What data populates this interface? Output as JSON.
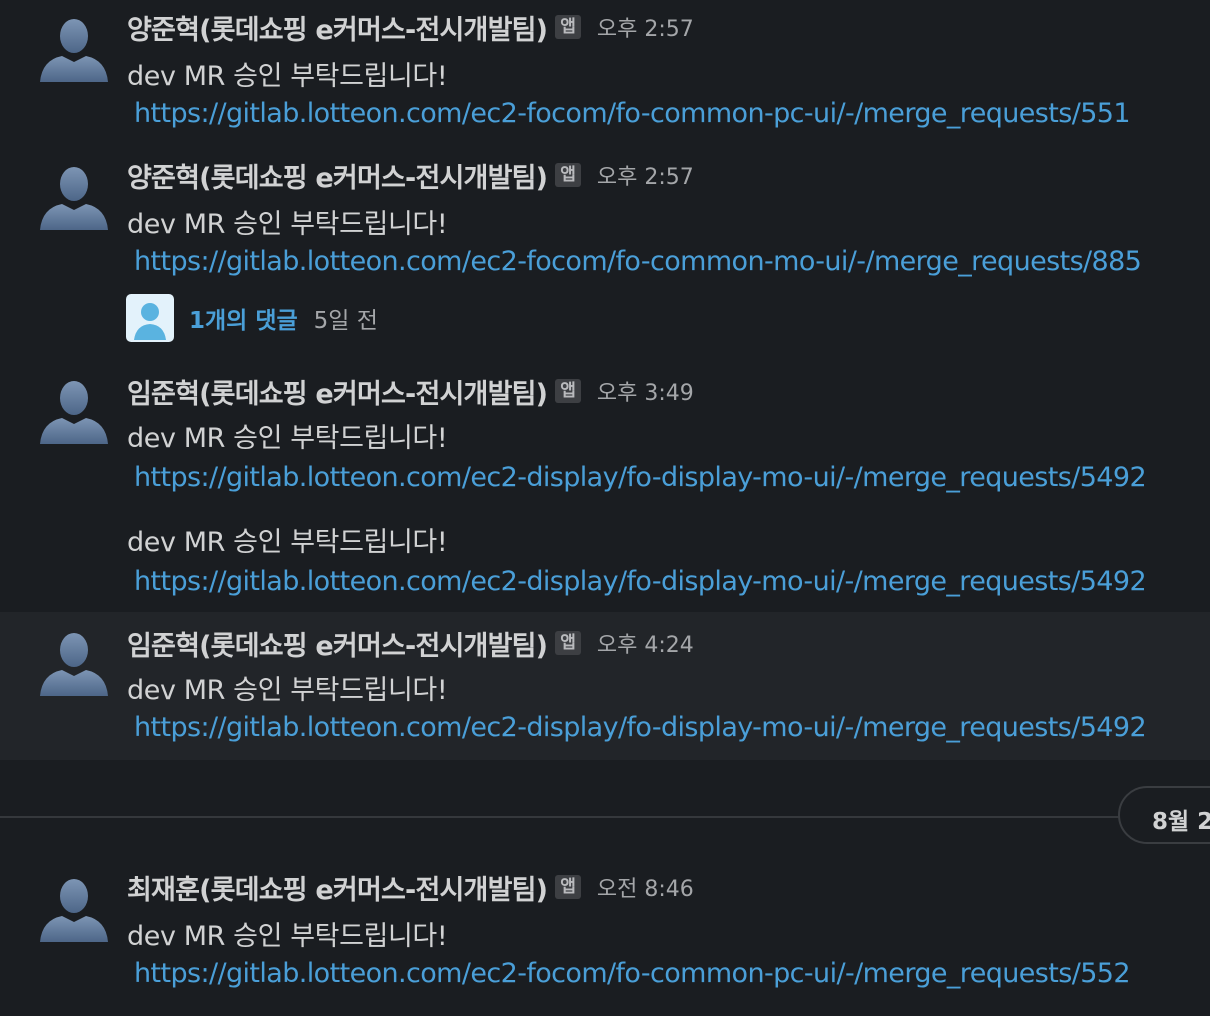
{
  "messages": [
    {
      "sender": "양준혁(롯데쇼핑 e커머스-전시개발팀)",
      "badge": "앱",
      "time": "오후 2:57",
      "text": "dev MR 승인 부탁드립니다!",
      "link": "https://gitlab.lotteon.com/ec2-focom/fo-common-pc-ui/-/merge_requests/551"
    },
    {
      "sender": "양준혁(롯데쇼핑 e커머스-전시개발팀)",
      "badge": "앱",
      "time": "오후 2:57",
      "text": "dev MR 승인 부탁드립니다!",
      "link": "https://gitlab.lotteon.com/ec2-focom/fo-common-mo-ui/-/merge_requests/885",
      "thread": {
        "replies": "1개의 댓글",
        "ago": "5일 전"
      }
    },
    {
      "sender": "임준혁(롯데쇼핑 e커머스-전시개발팀)",
      "badge": "앱",
      "time": "오후 3:49",
      "text": "dev MR 승인 부탁드립니다!",
      "link": "https://gitlab.lotteon.com/ec2-display/fo-display-mo-ui/-/merge_requests/5492",
      "continuation": {
        "text": "dev MR 승인 부탁드립니다!",
        "link": "https://gitlab.lotteon.com/ec2-display/fo-display-mo-ui/-/merge_requests/5492"
      }
    },
    {
      "sender": "임준혁(롯데쇼핑 e커머스-전시개발팀)",
      "badge": "앱",
      "time": "오후 4:24",
      "text": "dev MR 승인 부탁드립니다!",
      "link": "https://gitlab.lotteon.com/ec2-display/fo-display-mo-ui/-/merge_requests/5492"
    },
    {
      "sender": "최재훈(롯데쇼핑 e커머스-전시개발팀)",
      "badge": "앱",
      "time": "오전 8:46",
      "text": "dev MR 승인 부탁드립니다!",
      "link": "https://gitlab.lotteon.com/ec2-focom/fo-common-pc-ui/-/merge_requests/552"
    }
  ],
  "date_divider": {
    "label": "8월 2"
  },
  "icons": {
    "avatar": "default-user-avatar-icon",
    "thread_avatar": "user-avatar-icon"
  },
  "colors": {
    "background": "#1a1d21",
    "hover_background": "#222529",
    "link": "#4a9fd8",
    "text": "#d1d2d3",
    "muted": "#a4a6a9"
  }
}
